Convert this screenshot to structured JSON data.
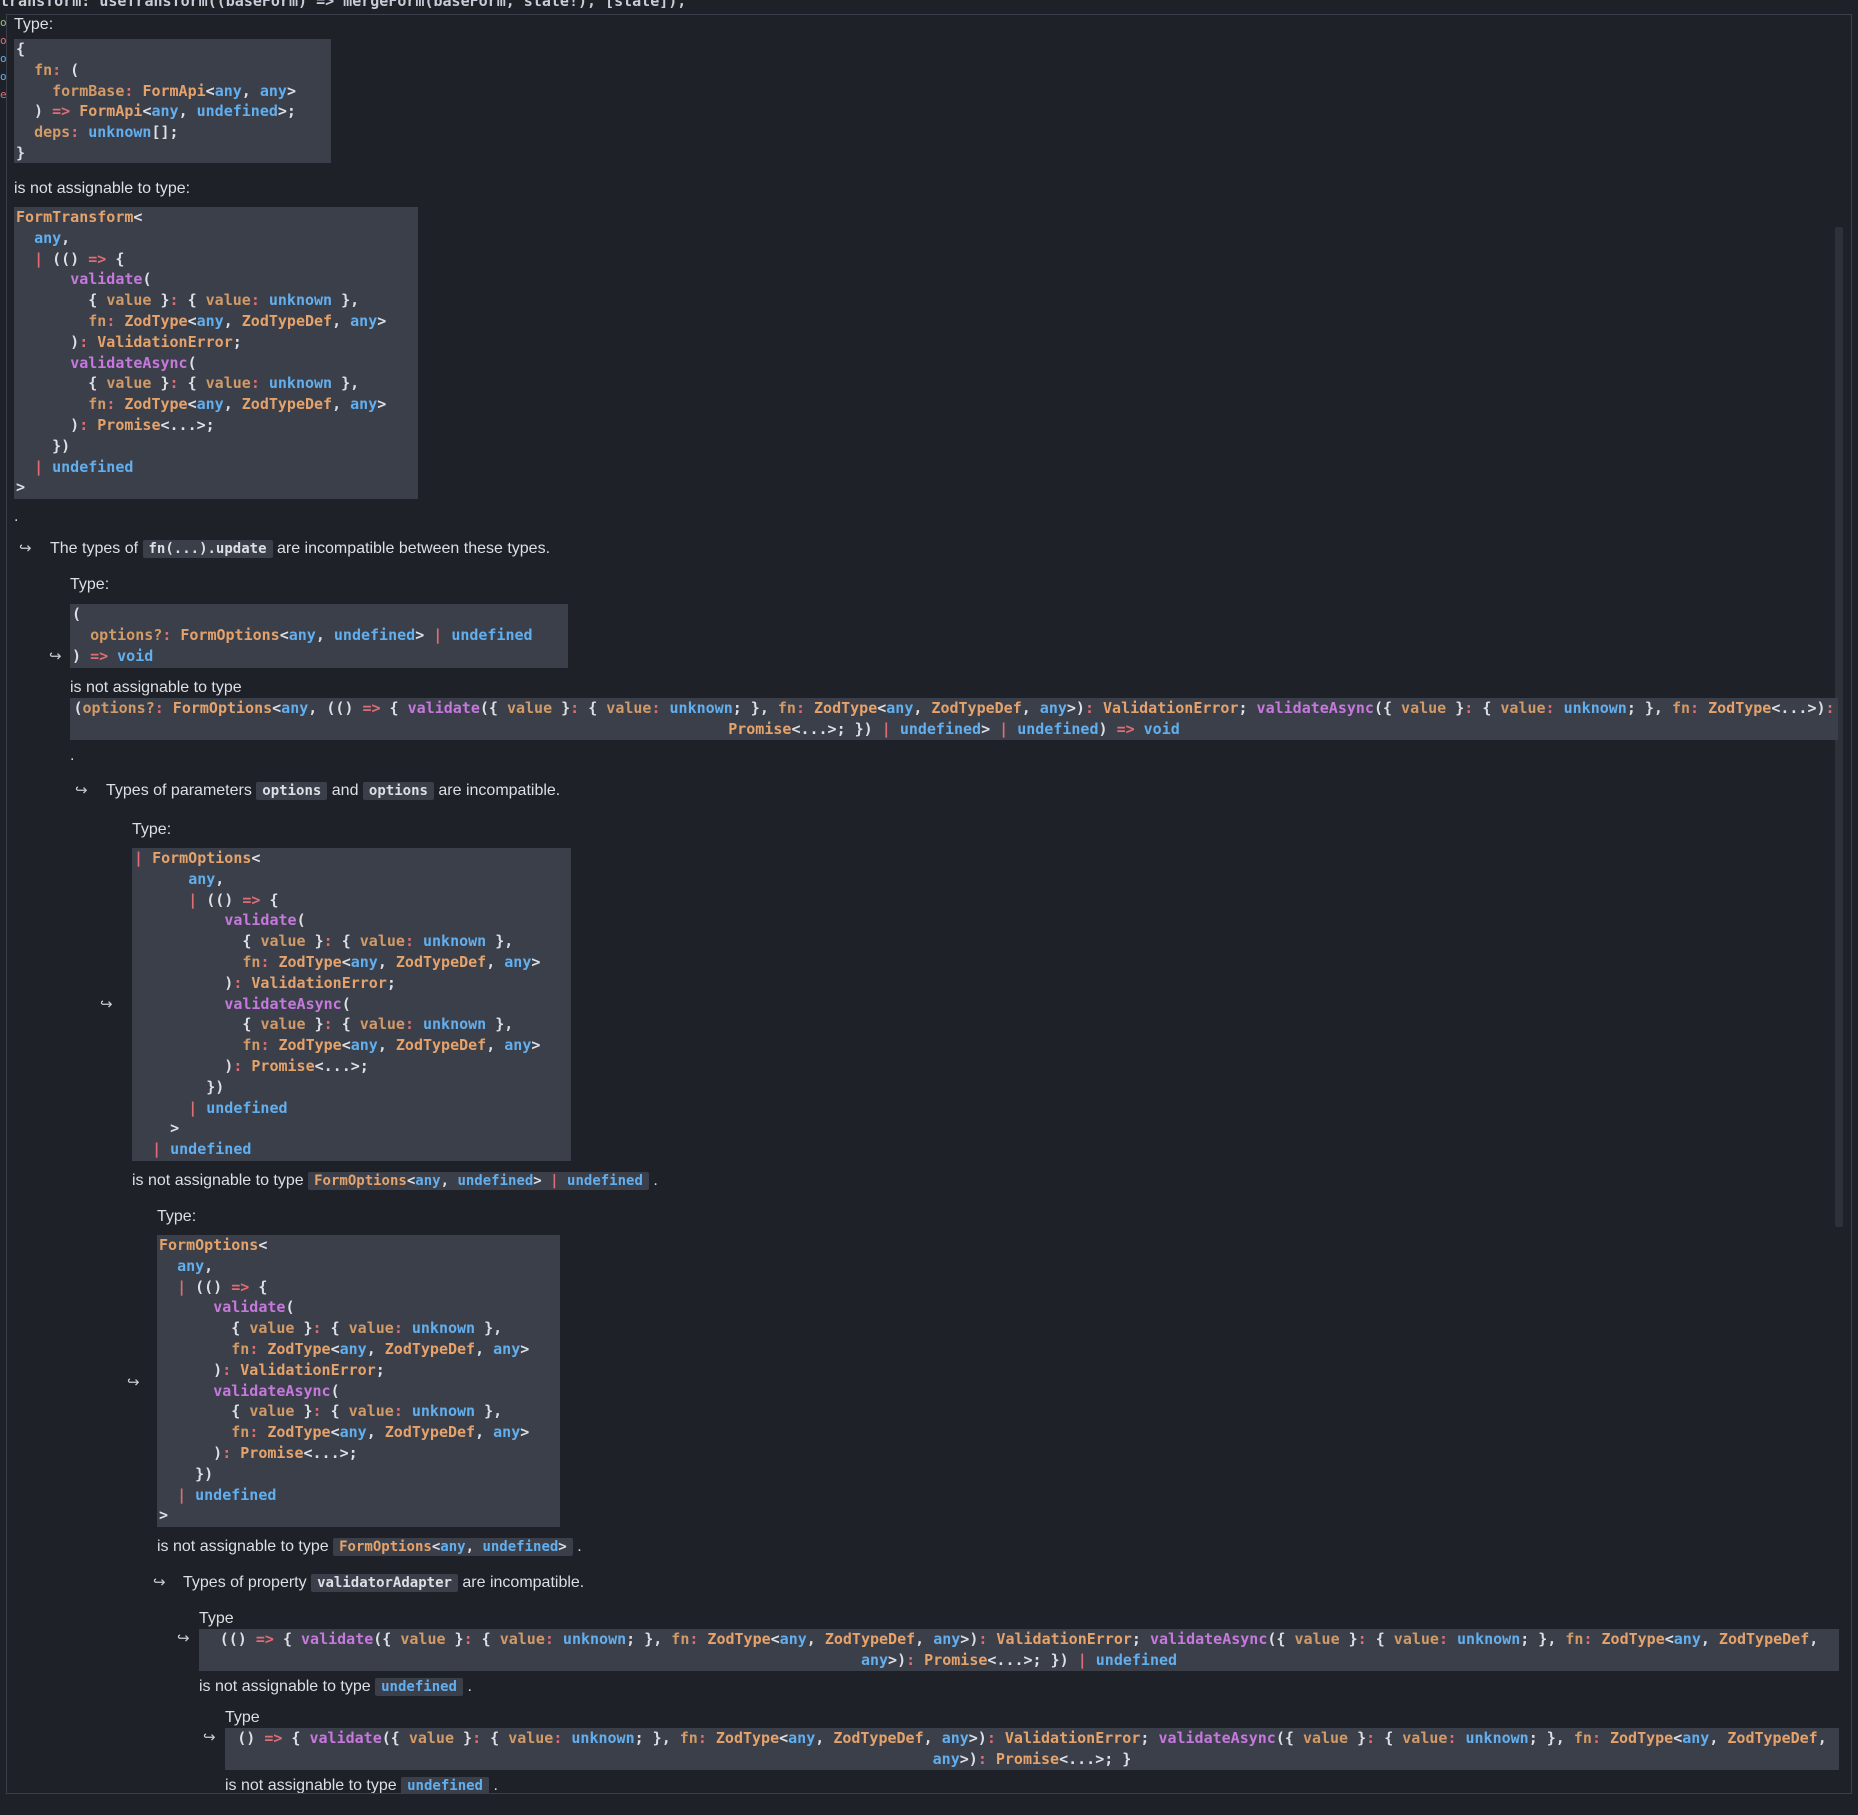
{
  "editor": {
    "source_line": "transform: useTransform((baseForm) => mergeForm(baseForm, state!), [state]),",
    "gutter_marks": [
      "o",
      "o",
      "o",
      "o",
      "e"
    ]
  },
  "hover": {
    "type_label": "Type:",
    "type_label_plain": "Type",
    "not_assignable_colon": "is not assignable to type:",
    "not_assignable": "is not assignable to type",
    "period": ".",
    "arrow_glyph": "↪",
    "msg_update_before": "The types of",
    "msg_update_code": "fn(...).update",
    "msg_update_after": "are incompatible between these types.",
    "msg_params_before": "Types of parameters",
    "msg_params_code1": "options",
    "msg_params_and": "and",
    "msg_params_code2": "options",
    "msg_params_after": "are incompatible.",
    "msg_prop_before": "Types of property",
    "msg_prop_code": "validatorAdapter",
    "msg_prop_after": "are incompatible.",
    "inline_formoptions_union": "FormOptions<any, undefined> | undefined",
    "inline_formoptions": "FormOptions<any, undefined>",
    "inline_undefined": "undefined"
  }
}
